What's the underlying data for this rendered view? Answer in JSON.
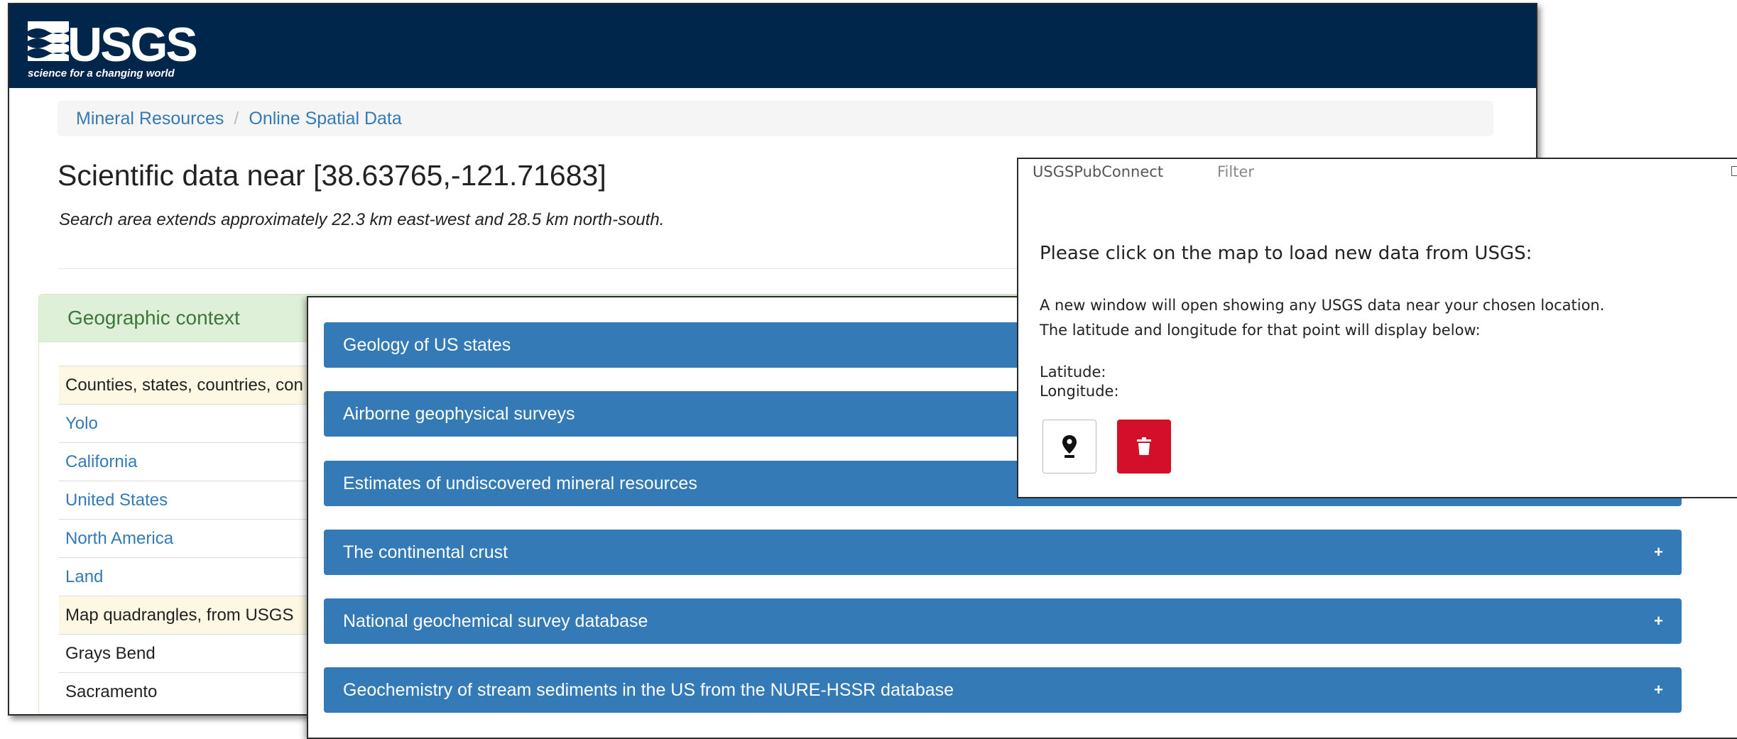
{
  "header": {
    "logo_text": "USGS",
    "logo_tagline": "science for a changing world"
  },
  "breadcrumb": [
    "Mineral Resources",
    "Online Spatial Data"
  ],
  "page": {
    "title": "Scientific data near [38.63765,-121.71683]",
    "subtitle": "Search area extends approximately 22.3 km east-west and 28.5 km north-south."
  },
  "geo_panel": {
    "heading": "Geographic context",
    "rows": [
      {
        "type": "head",
        "text": "Counties, states, countries, con"
      },
      {
        "type": "link",
        "text": "Yolo"
      },
      {
        "type": "link",
        "text": "California"
      },
      {
        "type": "link",
        "text": "United States"
      },
      {
        "type": "link",
        "text": "North America"
      },
      {
        "type": "link",
        "text": "Land"
      },
      {
        "type": "head",
        "text": "Map quadrangles, from USGS"
      },
      {
        "type": "plain",
        "text": "Grays Bend"
      },
      {
        "type": "plain",
        "text": "Sacramento"
      }
    ]
  },
  "accordion": {
    "items": [
      {
        "label": "Geology of US states",
        "show_plus": false
      },
      {
        "label": "Airborne geophysical surveys",
        "show_plus": false
      },
      {
        "label": "Estimates of undiscovered mineral resources",
        "show_plus": false
      },
      {
        "label": "The continental crust",
        "show_plus": true
      },
      {
        "label": "National geochemical survey database",
        "show_plus": true
      },
      {
        "label": "Geochemistry of stream sediments in the US from the NURE-HSSR database",
        "show_plus": true
      }
    ],
    "plus_symbol": "+"
  },
  "popup": {
    "tab_active": "USGSPubConnect",
    "tab_inactive": "Filter",
    "heading": "Please click on the map to load new data from USGS:",
    "line1": "A new window will open showing any USGS data near your chosen location.",
    "line2": "The latitude and longitude for that point will display below:",
    "latitude_label": "Latitude:",
    "longitude_label": "Longitude:",
    "pin_icon": "map-pin-icon",
    "delete_icon": "trash-icon",
    "delete_color": "#d40f2a"
  },
  "colors": {
    "header_bg": "#00264c",
    "link": "#337ab7",
    "accordion_bg": "#337ab7",
    "panel_heading_bg": "#dff0d8",
    "panel_heading_text": "#3c763d",
    "row_highlight": "#fcf8e3"
  }
}
